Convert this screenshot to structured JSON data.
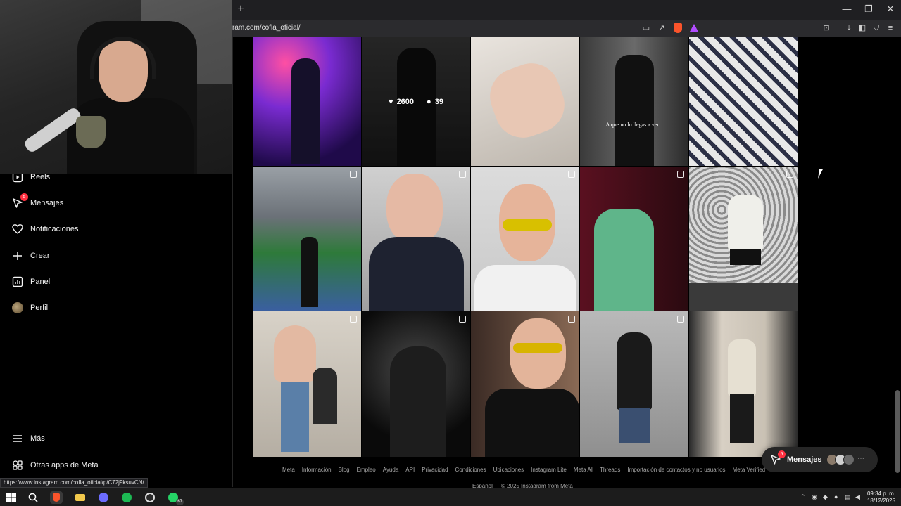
{
  "browser": {
    "url": "ram.com/cofla_oficial/",
    "new_tab_label": "+",
    "status_url": "https://www.instagram.com/cofla_oficial/p/C72j9ksuvCN/",
    "window_controls": [
      "—",
      "❐",
      "✕"
    ]
  },
  "sidebar": {
    "items": [
      {
        "label": "Reels",
        "icon": "reels-icon"
      },
      {
        "label": "Mensajes",
        "icon": "messenger-icon",
        "badge": "5"
      },
      {
        "label": "Notificaciones",
        "icon": "heart-icon"
      },
      {
        "label": "Crear",
        "icon": "plus-icon"
      },
      {
        "label": "Panel",
        "icon": "dashboard-icon"
      },
      {
        "label": "Perfil",
        "icon": "avatar"
      }
    ],
    "bottom_items": [
      {
        "label": "Más",
        "icon": "menu-icon"
      },
      {
        "label": "Otras apps de Meta",
        "icon": "meta-apps-icon"
      }
    ]
  },
  "grid": {
    "hover_likes": "2600",
    "hover_comments": "39",
    "caption_overlay": "A que no lo llegas a ver..."
  },
  "footer": {
    "links": [
      "Meta",
      "Información",
      "Blog",
      "Empleo",
      "Ayuda",
      "API",
      "Privacidad",
      "Condiciones",
      "Ubicaciones",
      "Instagram Lite",
      "Meta AI",
      "Threads",
      "Importación de contactos y no usuarios",
      "Meta Verified"
    ],
    "language": "Español",
    "copyright": "© 2025 Instagram from Meta"
  },
  "messages_pill": {
    "label": "Mensajes",
    "badge": "5"
  },
  "taskbar": {
    "time": "09:34 p. m.",
    "date": "18/12/2025",
    "whatsapp_badge": "67"
  }
}
